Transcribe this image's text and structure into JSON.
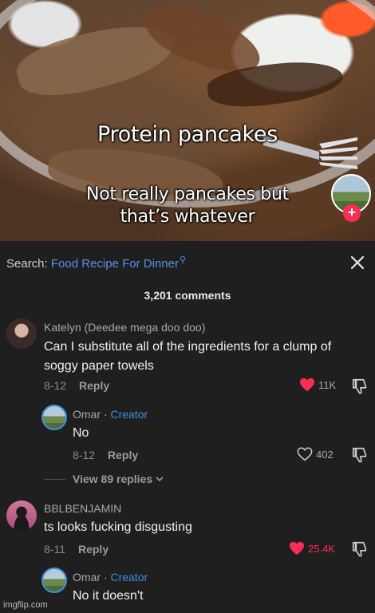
{
  "video": {
    "caption_main": "Protein pancakes",
    "caption_sub_line1": "Not really pancakes but",
    "caption_sub_line2": "that’s whatever",
    "follow_icon": "+"
  },
  "search": {
    "label": "Search:",
    "query": "Food Recipe For Dinner",
    "icon": "search-icon"
  },
  "close_icon": "×",
  "comments_count": "3,201 comments",
  "comments": [
    {
      "author": "Katelyn (Deedee mega doo doo)",
      "text_line1": "Can I substitute all of the ingredients for a clump of",
      "text_line2": "soggy paper towels",
      "date": "8-12",
      "reply_label": "Reply",
      "likes": "11K",
      "liked": true
    },
    {
      "author": "Omar",
      "author_sep": " · ",
      "author_badge": "Creator",
      "text": "No",
      "date": "8-12",
      "reply_label": "Reply",
      "likes": "402",
      "liked": false
    },
    {
      "author": "BBLBENJAMIN",
      "text": "ts looks fucking disgusting",
      "date": "8-11",
      "reply_label": "Reply",
      "likes": "25.4K",
      "liked": true
    },
    {
      "author": "Omar",
      "author_sep": " · ",
      "author_badge": "Creator",
      "text": "No it doesn't"
    }
  ],
  "view_replies": "View 89 replies",
  "watermark": "imgflip.com",
  "colors": {
    "accent_red": "#fe2c55",
    "link_blue": "#3d8fe0",
    "background": "#1f1f1f"
  }
}
